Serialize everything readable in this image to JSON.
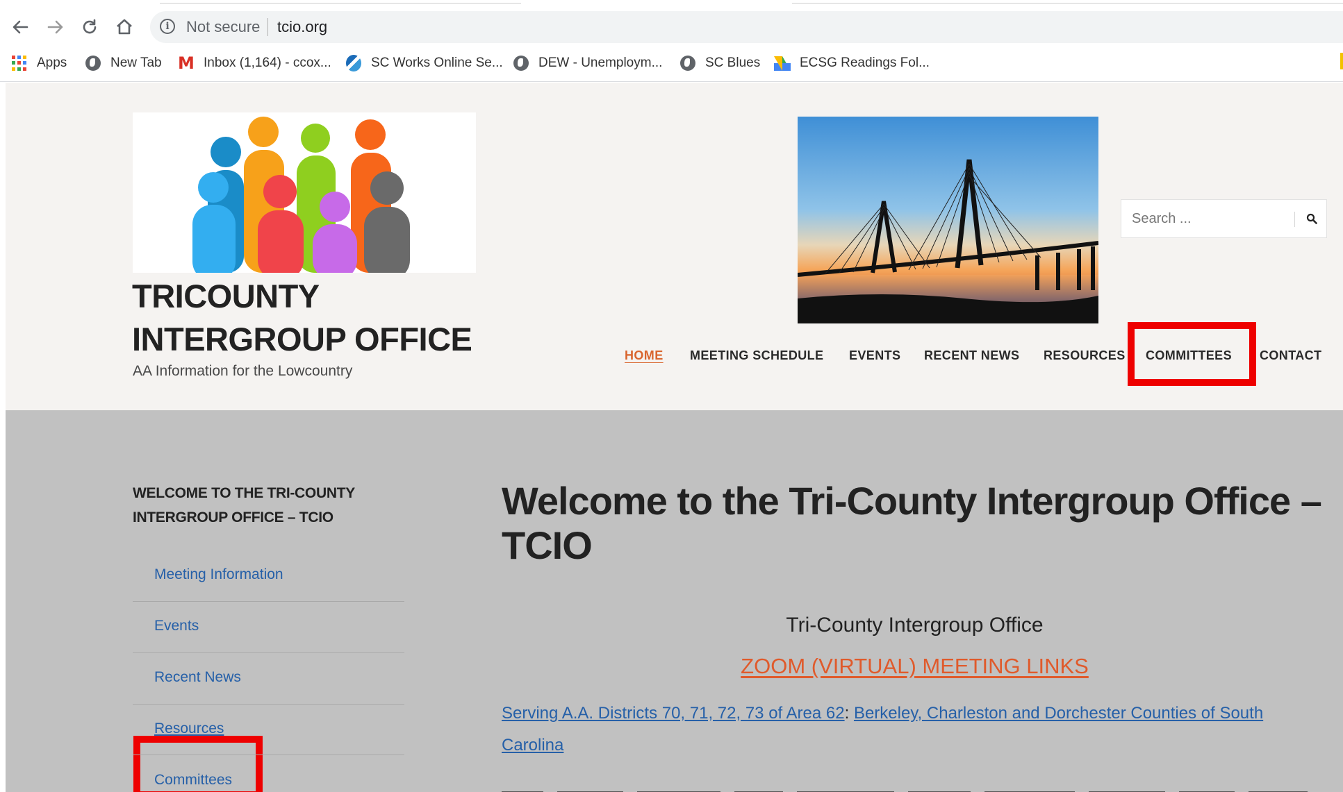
{
  "browser": {
    "security_label": "Not secure",
    "url": "tcio.org",
    "bookmarks": [
      {
        "label": "Apps",
        "icon": "apps-grid-icon"
      },
      {
        "label": "New Tab",
        "icon": "globe-icon"
      },
      {
        "label": "Inbox (1,164) - ccox...",
        "icon": "gmail-icon"
      },
      {
        "label": "SC Works Online Se...",
        "icon": "sc-works-icon"
      },
      {
        "label": "DEW - Unemploym...",
        "icon": "globe-icon"
      },
      {
        "label": "SC Blues",
        "icon": "globe-icon"
      },
      {
        "label": "ECSG Readings Fol...",
        "icon": "google-drive-icon"
      }
    ]
  },
  "site": {
    "title_line1": "TRICOUNTY",
    "title_line2": "INTERGROUP OFFICE",
    "tagline": "AA Information for the Lowcountry"
  },
  "search": {
    "placeholder": "Search ..."
  },
  "nav": {
    "home": "HOME",
    "meeting_schedule": "MEETING SCHEDULE",
    "events": "EVENTS",
    "recent_news": "RECENT NEWS",
    "resources": "RESOURCES",
    "committees": "COMMITTEES",
    "contact": "CONTACT"
  },
  "sidebar": {
    "widget_title_line1": "WELCOME TO THE TRI-COUNTY",
    "widget_title_line2": "INTERGROUP OFFICE – TCIO",
    "links": [
      "Meeting Information",
      "Events",
      "Recent News",
      "Resources",
      "Committees"
    ]
  },
  "main": {
    "title_line1": "Welcome to the Tri-County Intergroup Office –",
    "title_line2": "TCIO",
    "office_name": "Tri-County Intergroup Office",
    "zoom_link": "ZOOM (VIRTUAL) MEETING LINKS",
    "serving_link1": "Serving A.A. Districts 70, 71, 72, 73 of Area 62",
    "serving_separator": ":",
    "serving_link2_part1": "Berkeley, Charleston and Dorchester Counties of South",
    "serving_link2_part2": "Carolina"
  },
  "colors": {
    "accent_orange": "#d9652e",
    "link_blue": "#2660a8",
    "annotation_red": "#ee0000",
    "content_gray": "#c1c1c1",
    "header_bg": "#f5f3f1"
  }
}
